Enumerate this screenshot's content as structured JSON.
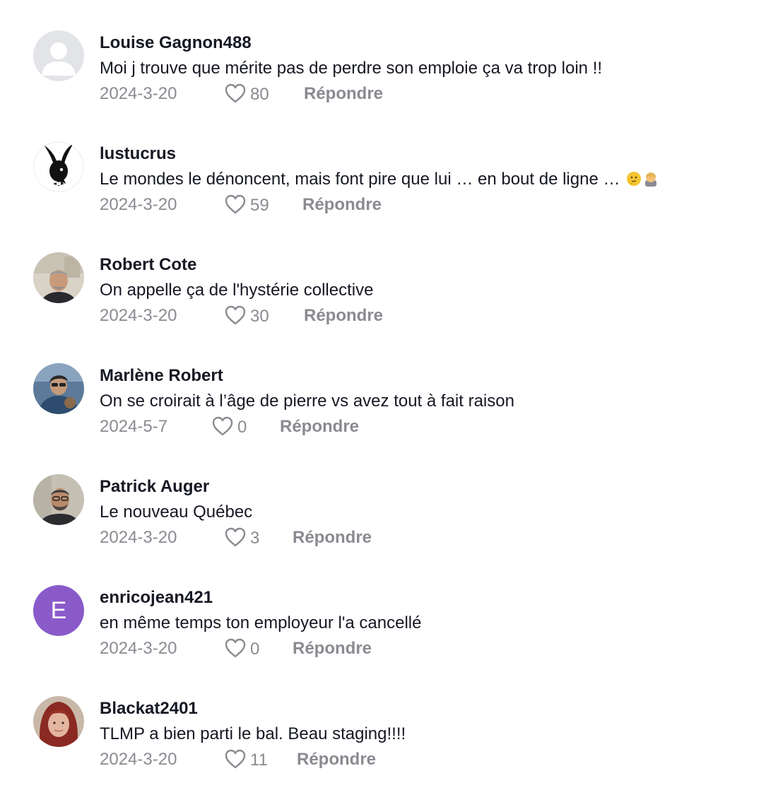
{
  "comments": [
    {
      "username": "Louise Gagnon488",
      "text": "Moi j trouve que mérite pas de perdre son emploie ça va trop loin !!",
      "date": "2024-3-20",
      "likes": "80",
      "reply": "Répondre",
      "avatar": "default-avatar-icon"
    },
    {
      "username": "lustucrus",
      "text": "Le mondes le dénoncent, mais font pire que lui … en bout de ligne … ",
      "emojis": [
        "thinking-face-emoji",
        "facepalm-emoji"
      ],
      "date": "2024-3-20",
      "likes": "59",
      "reply": "Répondre",
      "avatar": "bunny-logo-avatar"
    },
    {
      "username": "Robert Cote",
      "text": "On appelle ça de l'hystérie collective",
      "date": "2024-3-20",
      "likes": "30",
      "reply": "Répondre",
      "avatar": "photo-avatar"
    },
    {
      "username": "Marlène Robert",
      "text": "On se croirait à l’âge de pierre vs avez tout à fait raison",
      "date": "2024-5-7",
      "likes": "0",
      "reply": "Répondre",
      "avatar": "photo-avatar"
    },
    {
      "username": "Patrick Auger",
      "text": "Le nouveau Québec",
      "date": "2024-3-20",
      "likes": "3",
      "reply": "Répondre",
      "avatar": "photo-avatar"
    },
    {
      "username": "enricojean421",
      "text": "en même temps ton employeur l'a cancellé",
      "date": "2024-3-20",
      "likes": "0",
      "reply": "Répondre",
      "avatar": "initial-avatar",
      "initial": "E",
      "avatar_color": "#8a5ac9"
    },
    {
      "username": "Blackat2401",
      "text": "TLMP a bien parti le bal. Beau staging!!!!",
      "date": "2024-3-20",
      "likes": "11",
      "reply": "Répondre",
      "avatar": "photo-avatar"
    }
  ],
  "colors": {
    "username": "#161823",
    "text": "#161823",
    "meta": "#8a8b91"
  }
}
